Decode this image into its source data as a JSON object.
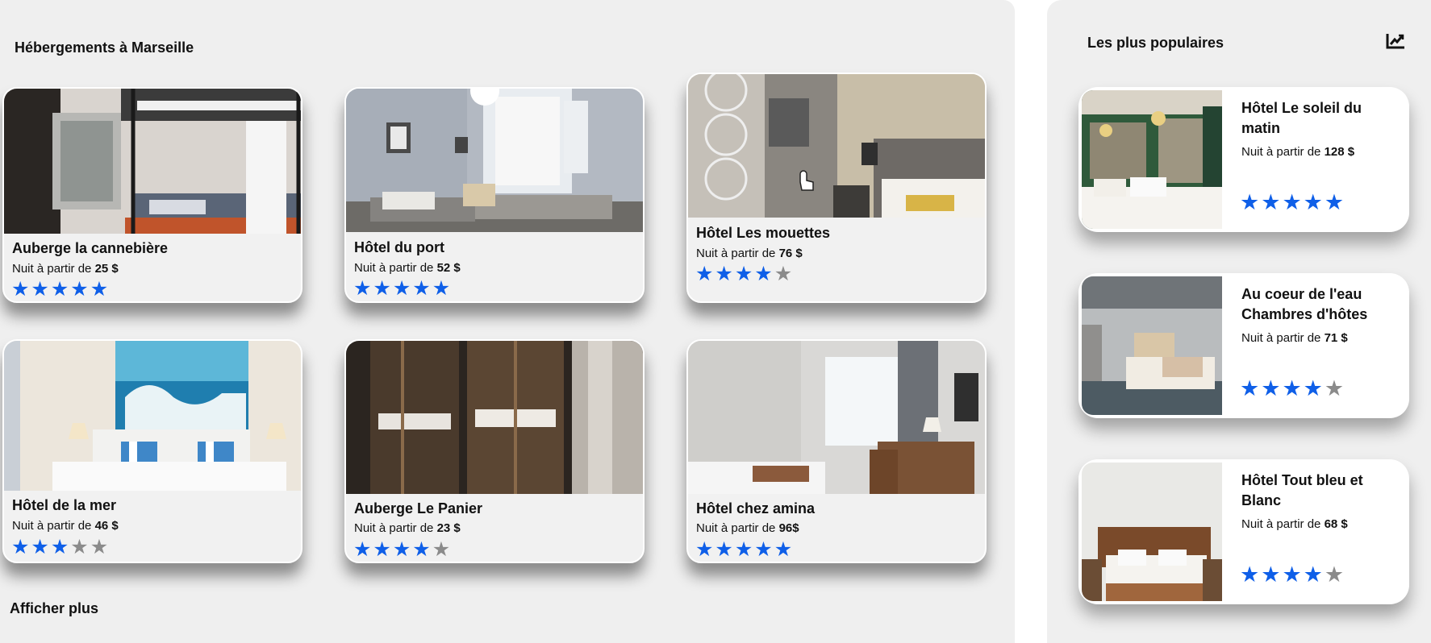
{
  "main": {
    "title": "Hébergements à Marseille",
    "show_more": "Afficher plus",
    "price_prefix": "Nuit à partir de",
    "cards": [
      {
        "name": "Auberge la cannebière",
        "price": "25 $",
        "rating": 5
      },
      {
        "name": "Hôtel du port",
        "price": "52 $",
        "rating": 5
      },
      {
        "name": "Hôtel Les mouettes",
        "price": "76 $",
        "rating": 4
      },
      {
        "name": "Hôtel de la mer",
        "price": "46 $",
        "rating": 3
      },
      {
        "name": "Auberge Le Panier",
        "price": "23 $",
        "rating": 4
      },
      {
        "name": "Hôtel chez amina",
        "price": "96$",
        "rating": 5
      }
    ]
  },
  "popular": {
    "title": "Les plus populaires",
    "icon": "trending-chart-icon",
    "price_prefix": "Nuit à partir de",
    "items": [
      {
        "name": "Hôtel Le soleil du matin",
        "price": "128 $",
        "rating": 5
      },
      {
        "name": "Au coeur de l'eau Chambres d'hôtes",
        "price": "71 $",
        "rating": 4
      },
      {
        "name": "Hôtel Tout bleu et Blanc",
        "price": "68 $",
        "rating": 4
      }
    ]
  },
  "colors": {
    "star_on": "#0f5fe8",
    "star_off": "#8b8b8b",
    "panel": "#efefef"
  }
}
